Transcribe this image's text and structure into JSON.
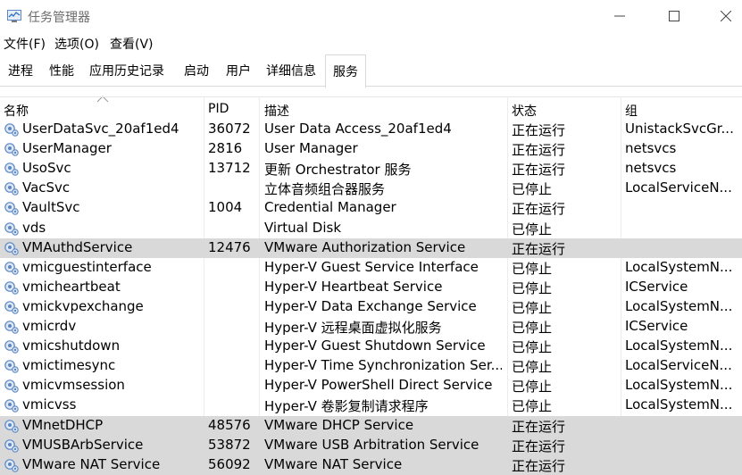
{
  "window": {
    "title": "任务管理器"
  },
  "menu": [
    "文件(F)",
    "选项(O)",
    "查看(V)"
  ],
  "tabs": [
    "进程",
    "性能",
    "应用历史记录",
    "启动",
    "用户",
    "详细信息",
    "服务"
  ],
  "active_tab": "服务",
  "columns": {
    "name": "名称",
    "pid": "PID",
    "desc": "描述",
    "status": "状态",
    "group": "组"
  },
  "sort": {
    "column": "name",
    "direction": "ascending"
  },
  "colors": {
    "selected_row": "#d9d9d9",
    "icon_blue": "#5b87c5"
  },
  "services": [
    {
      "name": "UserDataSvc_20af1ed4",
      "pid": "36072",
      "desc": "User Data Access_20af1ed4",
      "status": "正在运行",
      "group": "UnistackSvcGr..."
    },
    {
      "name": "UserManager",
      "pid": "2816",
      "desc": "User Manager",
      "status": "正在运行",
      "group": "netsvcs"
    },
    {
      "name": "UsoSvc",
      "pid": "13712",
      "desc": "更新 Orchestrator 服务",
      "status": "正在运行",
      "group": "netsvcs"
    },
    {
      "name": "VacSvc",
      "pid": "",
      "desc": "立体音频组合器服务",
      "status": "已停止",
      "group": "LocalServiceN..."
    },
    {
      "name": "VaultSvc",
      "pid": "1004",
      "desc": "Credential Manager",
      "status": "正在运行",
      "group": ""
    },
    {
      "name": "vds",
      "pid": "",
      "desc": "Virtual Disk",
      "status": "已停止",
      "group": ""
    },
    {
      "name": "VMAuthdService",
      "pid": "12476",
      "desc": "VMware Authorization Service",
      "status": "正在运行",
      "group": "",
      "selected": true
    },
    {
      "name": "vmicguestinterface",
      "pid": "",
      "desc": "Hyper-V Guest Service Interface",
      "status": "已停止",
      "group": "LocalSystemN..."
    },
    {
      "name": "vmicheartbeat",
      "pid": "",
      "desc": "Hyper-V Heartbeat Service",
      "status": "已停止",
      "group": "ICService"
    },
    {
      "name": "vmickvpexchange",
      "pid": "",
      "desc": "Hyper-V Data Exchange Service",
      "status": "已停止",
      "group": "LocalSystemN..."
    },
    {
      "name": "vmicrdv",
      "pid": "",
      "desc": "Hyper-V 远程桌面虚拟化服务",
      "status": "已停止",
      "group": "ICService"
    },
    {
      "name": "vmicshutdown",
      "pid": "",
      "desc": "Hyper-V Guest Shutdown Service",
      "status": "已停止",
      "group": "LocalSystemN..."
    },
    {
      "name": "vmictimesync",
      "pid": "",
      "desc": "Hyper-V Time Synchronization Ser...",
      "status": "已停止",
      "group": "LocalServiceN..."
    },
    {
      "name": "vmicvmsession",
      "pid": "",
      "desc": "Hyper-V PowerShell Direct Service",
      "status": "已停止",
      "group": "LocalSystemN..."
    },
    {
      "name": "vmicvss",
      "pid": "",
      "desc": "Hyper-V 卷影复制请求程序",
      "status": "已停止",
      "group": "LocalSystemN..."
    },
    {
      "name": "VMnetDHCP",
      "pid": "48576",
      "desc": "VMware DHCP Service",
      "status": "正在运行",
      "group": "",
      "selected": true
    },
    {
      "name": "VMUSBArbService",
      "pid": "53872",
      "desc": "VMware USB Arbitration Service",
      "status": "正在运行",
      "group": "",
      "selected": true
    },
    {
      "name": "VMware NAT Service",
      "pid": "56092",
      "desc": "VMware NAT Service",
      "status": "正在运行",
      "group": "",
      "selected": true
    }
  ]
}
